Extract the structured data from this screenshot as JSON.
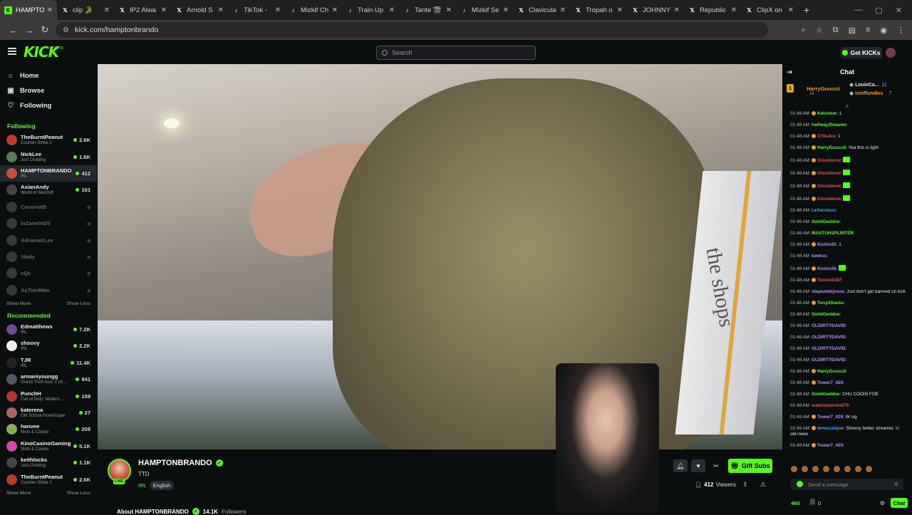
{
  "browser": {
    "tabs": [
      {
        "label": "HAMPTO",
        "fav_color": "#53fc18",
        "fav_text": "K",
        "active": true
      },
      {
        "label": "clip 🐊 ",
        "fav_color": "#1f1f1f",
        "fav_text": "𝕏",
        "active": false
      },
      {
        "label": "IP2 Alwa",
        "fav_color": "#1f1f1f",
        "fav_text": "𝕏",
        "active": false
      },
      {
        "label": "Arnold S",
        "fav_color": "#1f1f1f",
        "fav_text": "𝕏",
        "active": false
      },
      {
        "label": "TikTok - ",
        "fav_color": "#1f1f1f",
        "fav_text": "♪",
        "active": false
      },
      {
        "label": "Mizkif Ch",
        "fav_color": "#1f1f1f",
        "fav_text": "♪",
        "active": false
      },
      {
        "label": "Train Up",
        "fav_color": "#1f1f1f",
        "fav_text": "♪",
        "active": false
      },
      {
        "label": "Tante 🎬",
        "fav_color": "#1f1f1f",
        "fav_text": "♪",
        "active": false
      },
      {
        "label": "Mizkif Se",
        "fav_color": "#1f1f1f",
        "fav_text": "♪",
        "active": false
      },
      {
        "label": "Clavicula",
        "fav_color": "#1f1f1f",
        "fav_text": "𝕏",
        "active": false
      },
      {
        "label": "Tropah o",
        "fav_color": "#1f1f1f",
        "fav_text": "𝕏",
        "active": false
      },
      {
        "label": "JOHNNY o",
        "fav_color": "#1f1f1f",
        "fav_text": "𝕏",
        "active": false
      },
      {
        "label": "Republic",
        "fav_color": "#1f1f1f",
        "fav_text": "𝕏",
        "active": false
      },
      {
        "label": "ClipX on",
        "fav_color": "#1f1f1f",
        "fav_text": "𝕏",
        "active": false
      }
    ],
    "new_tab": "+",
    "url": "kick.com/hamptonbrando"
  },
  "header": {
    "logo": "KICK",
    "search_placeholder": "Search",
    "get_kicks": "Get KICKs"
  },
  "sidebar": {
    "nav": [
      {
        "label": "Home",
        "icon": "⌂"
      },
      {
        "label": "Browse",
        "icon": "▣"
      },
      {
        "label": "Following",
        "icon": "♡"
      }
    ],
    "following_title": "Following",
    "following": [
      {
        "name": "TheBurntPeanut",
        "category": "Counter-Strike 2",
        "viewers": "2.6K",
        "live": true,
        "color": "#c0392b",
        "selected": false
      },
      {
        "name": "NickLee",
        "category": "Just Chatting",
        "viewers": "1.6K",
        "live": true,
        "color": "#5a7a5a",
        "selected": false
      },
      {
        "name": "HAMPTONBRANDO",
        "category": "IRL",
        "viewers": "412",
        "live": true,
        "color": "#c84f3b",
        "selected": true
      },
      {
        "name": "AsianAndy",
        "category": "World of Warcraft",
        "viewers": "161",
        "live": true,
        "color": "#444",
        "selected": false
      },
      {
        "name": "CoconutB",
        "category": "",
        "viewers": "",
        "live": false,
        "color": "#777",
        "selected": false
      },
      {
        "name": "InZane0420",
        "category": "",
        "viewers": "",
        "live": false,
        "color": "#777",
        "selected": false
      },
      {
        "name": "AdrianahLee",
        "category": "",
        "viewers": "",
        "live": false,
        "color": "#777",
        "selected": false
      },
      {
        "name": "Vitaly",
        "category": "",
        "viewers": "",
        "live": false,
        "color": "#777",
        "selected": false
      },
      {
        "name": "xQc",
        "category": "",
        "viewers": "",
        "live": false,
        "color": "#777",
        "selected": false
      },
      {
        "name": "Ac7ionMan",
        "category": "",
        "viewers": "",
        "live": false,
        "color": "#777",
        "selected": false
      }
    ],
    "show_more": "Show More",
    "show_less": "Show Less",
    "recommended_title": "Recommended",
    "recommended": [
      {
        "name": "Edmatthews",
        "category": "IRL",
        "viewers": "7.2K",
        "color": "#6a4a9a"
      },
      {
        "name": "shoovy",
        "category": "IRL",
        "viewers": "2.2K",
        "color": "#eee"
      },
      {
        "name": "TJR",
        "category": "IRL",
        "viewers": "11.4K",
        "color": "#222"
      },
      {
        "name": "armaniyoungg",
        "category": "Grand Theft Auto V (G...",
        "viewers": "841",
        "color": "#556"
      },
      {
        "name": "PunchH",
        "category": "Call of Duty: Modern ...",
        "viewers": "159",
        "color": "#b33"
      },
      {
        "name": "katerena",
        "category": "Old School RuneScape",
        "viewers": "27",
        "color": "#a66"
      },
      {
        "name": "hanvee",
        "category": "Slots & Casino",
        "viewers": "208",
        "color": "#8a5"
      },
      {
        "name": "KinoCasinoGaming",
        "category": "Slots & Casino",
        "viewers": "5.1K",
        "color": "#d4a"
      },
      {
        "name": "keithlocks",
        "category": "Just Chatting",
        "viewers": "1.1K",
        "color": "#444"
      },
      {
        "name": "TheBurntPeanut",
        "category": "Counter-Strike 2",
        "viewers": "2.6K",
        "color": "#c0392b"
      }
    ]
  },
  "stream": {
    "streamer": "HAMPTONBRANDO",
    "live_badge": "LIVE",
    "title": "TTD",
    "category": "IRL",
    "tag": "English",
    "viewers": "412",
    "viewers_label": "Viewers",
    "gift_subs": "Gift Subs",
    "about": "About HAMPTONBRANDO",
    "followers": "14.1K",
    "followers_label": "Followers",
    "video_text": "the shops"
  },
  "chat": {
    "title": "Chat",
    "pinned_left_name": "HarryGuuccii",
    "pinned_left_rank": "1",
    "pinned_left_sub": "16",
    "pinned_right": [
      {
        "name": "LouieCa...",
        "count": "11"
      },
      {
        "name": "isniffundies",
        "count": "7"
      }
    ],
    "messages": [
      {
        "time": "01:48 AM",
        "user": "Ketchem",
        "color": "#53fc18",
        "text": ": 1",
        "emote": false,
        "badge": "#e89a2f"
      },
      {
        "time": "01:48 AM",
        "user": "halfway2heaven",
        "color": "#53fc18",
        "text": ":",
        "emote": false,
        "badge": ""
      },
      {
        "time": "01:48 AM",
        "user": "370uJee",
        "color": "#e05050",
        "text": ": 1",
        "emote": false,
        "badge": "#e89a2f"
      },
      {
        "time": "01:48 AM",
        "user": "HarryGuuccii",
        "color": "#53fc18",
        "text": ": Yea this is light",
        "emote": false,
        "badge": "#e89a2f"
      },
      {
        "time": "01:48 AM",
        "user": "Glocklenst",
        "color": "#e05050",
        "text": ":",
        "emote": true,
        "badge": "#e89a2f"
      },
      {
        "time": "01:48 AM",
        "user": "Glocklenst",
        "color": "#e05050",
        "text": ":",
        "emote": true,
        "badge": "#e89a2f"
      },
      {
        "time": "01:48 AM",
        "user": "Glocklenst",
        "color": "#e05050",
        "text": ":",
        "emote": true,
        "badge": "#e89a2f"
      },
      {
        "time": "01:48 AM",
        "user": "Glocklenst",
        "color": "#e05050",
        "text": ":",
        "emote": true,
        "badge": "#e89a2f"
      },
      {
        "time": "01:48 AM",
        "user": "LeServicus",
        "color": "#3ea0ff",
        "text": ":",
        "emote": false,
        "badge": ""
      },
      {
        "time": "01:48 AM",
        "user": "SolidGeddoe",
        "color": "#53fc18",
        "text": ":",
        "emote": false,
        "badge": ""
      },
      {
        "time": "01:48 AM",
        "user": "MASTUHSPLINTER",
        "color": "#53fc18",
        "text": ":",
        "emote": false,
        "badge": ""
      },
      {
        "time": "01:48 AM",
        "user": "Kishin2k",
        "color": "#b78cff",
        "text": ": 1",
        "emote": false,
        "badge": "#e89a2f"
      },
      {
        "time": "01:48 AM",
        "user": "keekss",
        "color": "#b78cff",
        "text": ":",
        "emote": false,
        "badge": ""
      },
      {
        "time": "01:48 AM",
        "user": "Kishin2k",
        "color": "#b78cff",
        "text": ":",
        "emote": true,
        "badge": "#e89a2f"
      },
      {
        "time": "01:48 AM",
        "user": "Twisted187",
        "color": "#e05050",
        "text": ":",
        "emote": false,
        "badge": "#e89a2f"
      },
      {
        "time": "01:48 AM",
        "user": "stepasidejesus",
        "color": "#b78cff",
        "text": ": Just don't get banned on kick",
        "emote": false,
        "badge": ""
      },
      {
        "time": "01:48 AM",
        "user": "Tony2Socks",
        "color": "#53fc18",
        "text": ":",
        "emote": false,
        "badge": "#e89a2f"
      },
      {
        "time": "01:48 AM",
        "user": "SolidGeddoe",
        "color": "#53fc18",
        "text": ":",
        "emote": false,
        "badge": ""
      },
      {
        "time": "01:48 AM",
        "user": "OLDIRTYDAVID",
        "color": "#b78cff",
        "text": ":",
        "emote": false,
        "badge": ""
      },
      {
        "time": "01:48 AM",
        "user": "OLDIRTYDAVID",
        "color": "#b78cff",
        "text": ":",
        "emote": false,
        "badge": ""
      },
      {
        "time": "01:48 AM",
        "user": "OLDIRTYDAVID",
        "color": "#b78cff",
        "text": ":",
        "emote": false,
        "badge": ""
      },
      {
        "time": "01:48 AM",
        "user": "OLDIRTYDAVID",
        "color": "#b78cff",
        "text": ":",
        "emote": false,
        "badge": ""
      },
      {
        "time": "01:48 AM",
        "user": "HarryGuuccii",
        "color": "#53fc18",
        "text": ":",
        "emote": false,
        "badge": "#e89a2f"
      },
      {
        "time": "01:48 AM",
        "user": "Tower7_420",
        "color": "#b78cff",
        "text": ":",
        "emote": false,
        "badge": "#e89a2f"
      },
      {
        "time": "01:48 AM",
        "user": "SolidGeddoe",
        "color": "#53fc18",
        "text": ": CHU CODIN FOE",
        "emote": false,
        "badge": ""
      },
      {
        "time": "01:48 AM",
        "user": "watermelonkid75",
        "color": "#e05050",
        "text": ":",
        "emote": false,
        "badge": ""
      },
      {
        "time": "01:49 AM",
        "user": "Tower7_420",
        "color": "#b78cff",
        "text": ": W cig",
        "emote": false,
        "badge": "#e89a2f"
      },
      {
        "time": "01:49 AM",
        "user": "temeculajoe",
        "color": "#3ea0ff",
        "text": ": Shoovy better streamer. U old news",
        "emote": false,
        "badge": "#e89a2f"
      },
      {
        "time": "01:49 AM",
        "user": "Tower7_420",
        "color": "#b78cff",
        "text": ":",
        "emote": false,
        "badge": "#e89a2f"
      }
    ],
    "input_placeholder": "Send a message",
    "points": "460",
    "gift_count": "0",
    "chat_button": "Chat"
  }
}
